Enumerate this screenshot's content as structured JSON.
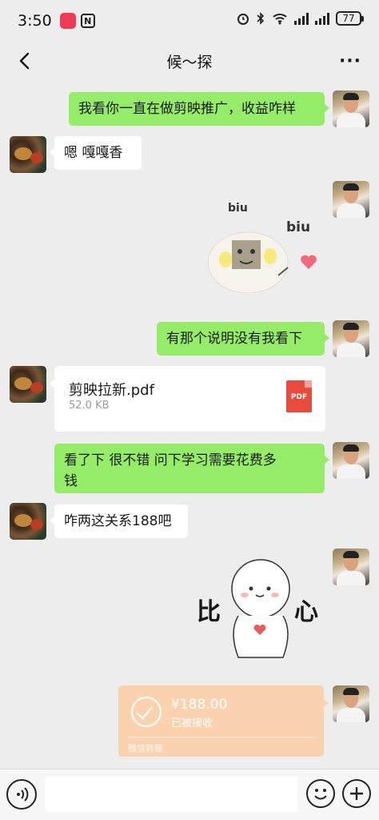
{
  "status_bar": {
    "time": "3:50",
    "battery": "77"
  },
  "nav": {
    "title": "候～探",
    "more": "···"
  },
  "messages": [
    {
      "text": "我看你一直在做剪映推广，收益咋样"
    },
    {
      "text": "嗯  嘎嘎香"
    },
    {
      "sticker_text_a": "biu",
      "sticker_text_b": "biu"
    },
    {
      "text": "有那个说明没有我看下"
    },
    {
      "file_name": "剪映拉新.pdf",
      "file_size": "52.0 KB",
      "file_type": "PDF"
    },
    {
      "text_line1": "看了下  很不错  问下学习需要花费多",
      "text_line2": "钱"
    },
    {
      "text": "咋两这关系188吧"
    },
    {
      "sticker_left": "比",
      "sticker_right": "心"
    },
    {
      "amount": "¥188.00",
      "status": "已被接收",
      "footer": "微信转账"
    }
  ],
  "input": {
    "placeholder": ""
  },
  "colors": {
    "bubble_green": "#95ec69",
    "transfer_bg": "#fad2af",
    "pdf_red": "#e64b3c",
    "background": "#ededed"
  },
  "icons": [
    "back-icon",
    "more-icon",
    "voice-icon",
    "emoji-icon",
    "plus-icon",
    "pdf-file-icon",
    "check-circle-icon",
    "heart-icon",
    "wifi-icon",
    "bluetooth-icon",
    "alarm-icon",
    "signal-icon",
    "battery-icon"
  ]
}
